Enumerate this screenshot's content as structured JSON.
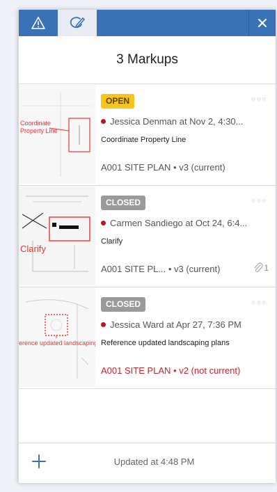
{
  "tabs": [
    {
      "icon": "warning-icon"
    },
    {
      "icon": "markup-pencil-icon"
    }
  ],
  "header": {
    "title": "3 Markups"
  },
  "markups": [
    {
      "status": "OPEN",
      "author": "Jessica Denman at Nov 2, 4:30...",
      "note": "Coordinate Property Line",
      "sheet": "A001 SITE PLAN • v3 (current)",
      "thumb_text": "Coordinate Property Line"
    },
    {
      "status": "CLOSED",
      "author": "Carmen Sandiego at Oct 24, 6:4...",
      "note": "Clarify",
      "sheet": "A001 SITE PL...  • v3 (current)",
      "attachments": "1",
      "thumb_text": "Clarify"
    },
    {
      "status": "CLOSED",
      "author": "Jessica Ward at Apr 27, 7:36 PM",
      "note": "Reference updated landscaping plans",
      "sheet": "A001 SITE PLAN • v2 (not current)",
      "thumb_text": "erence updated landscaping"
    }
  ],
  "footer": {
    "updated": "Updated at 4:48 PM"
  },
  "colors": {
    "accent": "#3a73b5",
    "open_badge": "#f7c518",
    "closed_badge": "#9a9a9a",
    "alert_red": "#d0202a"
  }
}
